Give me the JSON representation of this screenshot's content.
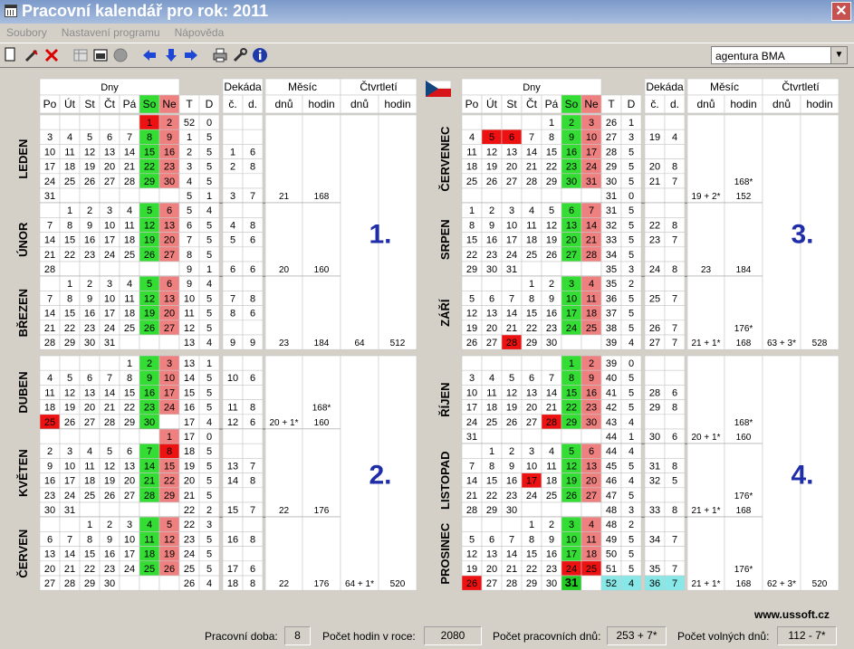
{
  "window": {
    "title": "Pracovní kalendář pro rok: 2011"
  },
  "menu": [
    {
      "label": "Soubory"
    },
    {
      "label": "Nastavení programu"
    },
    {
      "label": "Nápověda"
    }
  ],
  "toolbar": {
    "icons": [
      "new-icon",
      "edit-icon",
      "delete-icon",
      "table-icon",
      "grid-icon",
      "circle-icon",
      "arrow-left-icon",
      "arrow-down-icon",
      "arrow-right-icon",
      "print-icon",
      "tools-icon",
      "info-icon"
    ],
    "agency_value": "agentura BMA"
  },
  "colors": {
    "workday": "#ffffff",
    "saturday": "#33dd33",
    "sunday": "#ef8080",
    "holiday": "#ee1111",
    "today": "#22cc22",
    "highlight": "#88e8e8",
    "quarter_number": "#1f2ea8"
  },
  "headers": {
    "dny": "Dny",
    "dekada": "Dekáda",
    "mesic": "Měsíc",
    "ctvrtleti": "Čtvrtletí",
    "days": [
      "Po",
      "Út",
      "St",
      "Čt",
      "Pá",
      "So",
      "Ne"
    ],
    "t": "T",
    "d": "D",
    "c": "č.",
    "dd": "d.",
    "dnu": "dnů",
    "hodin": "hodin"
  },
  "months": [
    {
      "name": "LEDEN",
      "start": 5,
      "days": 31,
      "holidays": [
        1
      ],
      "weeks": [
        [
          52,
          0
        ],
        [
          1,
          5
        ],
        [
          2,
          5
        ],
        [
          3,
          5
        ],
        [
          4,
          5
        ],
        [
          5,
          1
        ]
      ],
      "dekady": [
        [
          "",
          ""
        ],
        [
          "",
          ""
        ],
        [
          "1",
          "6"
        ],
        [
          "2",
          "8"
        ],
        [
          "",
          ""
        ],
        [
          "3",
          "7"
        ]
      ],
      "dnu": "21",
      "hodin": "168",
      "hodin_star": ""
    },
    {
      "name": "ÚNOR",
      "start": 1,
      "days": 28,
      "holidays": [],
      "weeks": [
        [
          5,
          4
        ],
        [
          6,
          5
        ],
        [
          7,
          5
        ],
        [
          8,
          5
        ],
        [
          9,
          1
        ]
      ],
      "dekady": [
        [
          "",
          ""
        ],
        [
          "4",
          "8"
        ],
        [
          "5",
          "6"
        ],
        [
          "",
          ""
        ],
        [
          "6",
          "6"
        ]
      ],
      "dnu": "20",
      "hodin": "160",
      "hodin_star": ""
    },
    {
      "name": "BŘEZEN",
      "start": 1,
      "days": 31,
      "holidays": [],
      "weeks": [
        [
          9,
          4
        ],
        [
          10,
          5
        ],
        [
          11,
          5
        ],
        [
          12,
          5
        ],
        [
          13,
          4
        ]
      ],
      "dekady": [
        [
          "",
          ""
        ],
        [
          "7",
          "8"
        ],
        [
          "8",
          "6"
        ],
        [
          "",
          ""
        ],
        [
          "9",
          "9"
        ]
      ],
      "dnu": "23",
      "hodin": "184",
      "hodin_star": ""
    },
    {
      "name": "DUBEN",
      "start": 4,
      "days": 30,
      "holidays": [
        25
      ],
      "weeks": [
        [
          13,
          1
        ],
        [
          14,
          5
        ],
        [
          15,
          5
        ],
        [
          16,
          5
        ],
        [
          17,
          4
        ]
      ],
      "dekady": [
        [
          "",
          ""
        ],
        [
          "10",
          "6"
        ],
        [
          "",
          ""
        ],
        [
          "11",
          "8"
        ],
        [
          "12",
          "6"
        ]
      ],
      "dnu": "20 + 1*",
      "hodin": "160",
      "hodin_star": "168*"
    },
    {
      "name": "KVĚTEN",
      "start": 6,
      "days": 31,
      "holidays": [
        8
      ],
      "weeks": [
        [
          17,
          0
        ],
        [
          18,
          5
        ],
        [
          19,
          5
        ],
        [
          20,
          5
        ],
        [
          21,
          5
        ],
        [
          22,
          2
        ]
      ],
      "dekady": [
        [
          "",
          ""
        ],
        [
          "",
          ""
        ],
        [
          "13",
          "7"
        ],
        [
          "14",
          "8"
        ],
        [
          "",
          ""
        ],
        [
          "15",
          "7"
        ]
      ],
      "dnu": "22",
      "hodin": "176",
      "hodin_star": ""
    },
    {
      "name": "ČERVEN",
      "start": 2,
      "days": 30,
      "holidays": [],
      "weeks": [
        [
          22,
          3
        ],
        [
          23,
          5
        ],
        [
          24,
          5
        ],
        [
          25,
          5
        ],
        [
          26,
          4
        ]
      ],
      "dekady": [
        [
          "",
          ""
        ],
        [
          "16",
          "8"
        ],
        [
          "",
          ""
        ],
        [
          "17",
          "6"
        ],
        [
          "18",
          "8"
        ]
      ],
      "dnu": "22",
      "hodin": "176",
      "hodin_star": ""
    },
    {
      "name": "ČERVENEC",
      "start": 4,
      "days": 31,
      "holidays": [
        5,
        6
      ],
      "weeks": [
        [
          26,
          1
        ],
        [
          27,
          3
        ],
        [
          28,
          5
        ],
        [
          29,
          5
        ],
        [
          30,
          5
        ],
        [
          31,
          0
        ]
      ],
      "dekady": [
        [
          "",
          ""
        ],
        [
          "19",
          "4"
        ],
        [
          "",
          ""
        ],
        [
          "20",
          "8"
        ],
        [
          "21",
          "7"
        ],
        [
          "",
          ""
        ]
      ],
      "dnu": "19 + 2*",
      "hodin": "152",
      "hodin_star": "168*"
    },
    {
      "name": "SRPEN",
      "start": 0,
      "days": 31,
      "holidays": [],
      "weeks": [
        [
          31,
          5
        ],
        [
          32,
          5
        ],
        [
          33,
          5
        ],
        [
          34,
          5
        ],
        [
          35,
          3
        ]
      ],
      "dekady": [
        [
          "",
          ""
        ],
        [
          "22",
          "8"
        ],
        [
          "23",
          "7"
        ],
        [
          "",
          ""
        ],
        [
          "24",
          "8"
        ]
      ],
      "dnu": "23",
      "hodin": "184",
      "hodin_star": ""
    },
    {
      "name": "ZÁŘÍ",
      "start": 3,
      "days": 30,
      "holidays": [
        28
      ],
      "weeks": [
        [
          35,
          2
        ],
        [
          36,
          5
        ],
        [
          37,
          5
        ],
        [
          38,
          5
        ],
        [
          39,
          4
        ]
      ],
      "dekady": [
        [
          "",
          ""
        ],
        [
          "25",
          "7"
        ],
        [
          "",
          ""
        ],
        [
          "26",
          "7"
        ],
        [
          "27",
          "7"
        ]
      ],
      "dnu": "21 + 1*",
      "hodin": "168",
      "hodin_star": "176*"
    },
    {
      "name": "ŘÍJEN",
      "start": 5,
      "days": 31,
      "holidays": [
        28
      ],
      "weeks": [
        [
          39,
          0
        ],
        [
          40,
          5
        ],
        [
          41,
          5
        ],
        [
          42,
          5
        ],
        [
          43,
          4
        ],
        [
          44,
          1
        ]
      ],
      "dekady": [
        [
          "",
          ""
        ],
        [
          "",
          ""
        ],
        [
          "28",
          "6"
        ],
        [
          "29",
          "8"
        ],
        [
          "",
          ""
        ],
        [
          "30",
          "6"
        ]
      ],
      "dnu": "20 + 1*",
      "hodin": "160",
      "hodin_star": "168*"
    },
    {
      "name": "LISTOPAD",
      "start": 1,
      "days": 30,
      "holidays": [
        17
      ],
      "weeks": [
        [
          44,
          4
        ],
        [
          45,
          5
        ],
        [
          46,
          4
        ],
        [
          47,
          5
        ],
        [
          48,
          3
        ]
      ],
      "dekady": [
        [
          "",
          ""
        ],
        [
          "31",
          "8"
        ],
        [
          "32",
          "5"
        ],
        [
          "",
          ""
        ],
        [
          "33",
          "8"
        ]
      ],
      "dnu": "21 + 1*",
      "hodin": "168",
      "hodin_star": "176*"
    },
    {
      "name": "PROSINEC",
      "start": 3,
      "days": 31,
      "holidays": [
        24,
        25,
        26
      ],
      "weeks": [
        [
          48,
          2
        ],
        [
          49,
          5
        ],
        [
          50,
          5
        ],
        [
          51,
          5
        ],
        [
          52,
          4
        ]
      ],
      "dekady": [
        [
          "",
          ""
        ],
        [
          "34",
          "7"
        ],
        [
          "",
          ""
        ],
        [
          "35",
          "7"
        ],
        [
          "36",
          "7"
        ]
      ],
      "dnu": "21 + 1*",
      "hodin": "168",
      "hodin_star": "176*"
    }
  ],
  "quarters": [
    {
      "number": "1.",
      "dnu": "64",
      "hodin": "512"
    },
    {
      "number": "2.",
      "dnu": "64 + 1*",
      "hodin": "520"
    },
    {
      "number": "3.",
      "dnu": "63 + 3*",
      "hodin": "528"
    },
    {
      "number": "4.",
      "dnu": "62 + 3*",
      "hodin": "520"
    }
  ],
  "highlight": {
    "today": 31,
    "week": "52",
    "days": "4",
    "decade_no": "36",
    "decade_days": "7"
  },
  "website": "www.ussoft.cz",
  "status": {
    "pracovni_doba_label": "Pracovní doba:",
    "pracovni_doba_value": "8",
    "pocet_hodin_label": "Počet hodin v roce:",
    "pocet_hodin_value": "2080",
    "pracovnich_dnu_label": "Počet pracovních dnů:",
    "pracovnich_dnu_value": "253 + 7*",
    "volnych_dnu_label": "Počet volných dnů:",
    "volnych_dnu_value": "112 - 7*"
  }
}
